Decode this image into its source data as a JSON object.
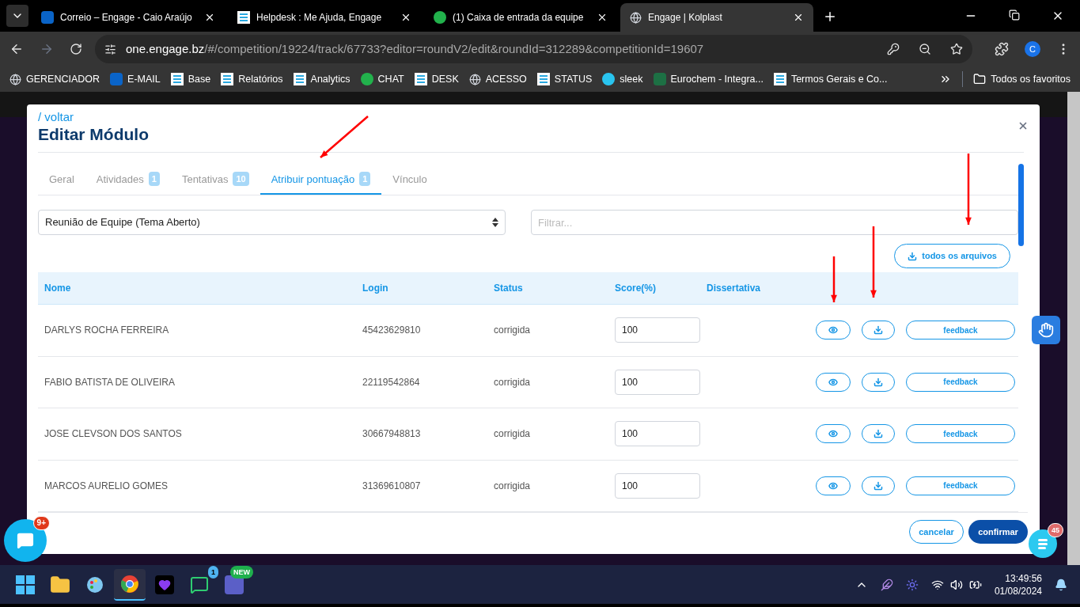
{
  "browser": {
    "tabs": [
      {
        "title": "Correio – Engage - Caio Araújo",
        "selected": false,
        "kind": "outlook"
      },
      {
        "title": "Helpdesk : Me Ajuda, Engage",
        "selected": false,
        "kind": "engage"
      },
      {
        "title": "(1) Caixa de entrada da equipe",
        "selected": false,
        "kind": "chat"
      },
      {
        "title": "Engage | Kolplast",
        "selected": true,
        "kind": "globe"
      }
    ],
    "url_host": "one.engage.bz",
    "url_path": "/#/competition/19224/track/67733?editor=roundV2/edit&roundId=312289&competitionId=19607",
    "profile": "C",
    "bookmarks": [
      {
        "label": "GERENCIADOR",
        "kind": "globe"
      },
      {
        "label": "E-MAIL",
        "kind": "outlook"
      },
      {
        "label": "Base",
        "kind": "engage"
      },
      {
        "label": "Relatórios",
        "kind": "engage"
      },
      {
        "label": "Analytics",
        "kind": "engage"
      },
      {
        "label": "CHAT",
        "kind": "chat"
      },
      {
        "label": "DESK",
        "kind": "engage"
      },
      {
        "label": "ACESSO",
        "kind": "globe"
      },
      {
        "label": "STATUS",
        "kind": "engage"
      },
      {
        "label": "sleek",
        "kind": "sleek"
      },
      {
        "label": "Eurochem - Integra...",
        "kind": "excel"
      },
      {
        "label": "Termos Gerais e Co...",
        "kind": "engage"
      }
    ],
    "all_bookmarks": "Todos os favoritos"
  },
  "page": {
    "chat_badge": "9+",
    "helper_badge": "45"
  },
  "modal": {
    "back": "/ voltar",
    "title": "Editar Módulo",
    "tabs": [
      {
        "label": "Geral",
        "selected": false
      },
      {
        "label": "Atividades",
        "count": "1",
        "selected": false
      },
      {
        "label": "Tentativas",
        "count": "10",
        "selected": false
      },
      {
        "label": "Atribuir pontuação",
        "count": "1",
        "selected": true
      },
      {
        "label": "Vínculo",
        "selected": false
      }
    ],
    "select_value": "Reunião de Equipe (Tema Aberto)",
    "filter_placeholder": "Filtrar...",
    "download_all": "todos os arquivos",
    "columns": [
      "Nome",
      "Login",
      "Status",
      "Score(%)",
      "Dissertativa"
    ],
    "rows": [
      {
        "name": "DARLYS ROCHA FERREIRA",
        "login": "45423629810",
        "status": "corrigida",
        "score": "100",
        "action": "feedback"
      },
      {
        "name": "FABIO BATISTA DE OLIVEIRA",
        "login": "22119542864",
        "status": "corrigida",
        "score": "100",
        "action": "feedback"
      },
      {
        "name": "JOSE CLEVSON DOS SANTOS",
        "login": "30667948813",
        "status": "corrigida",
        "score": "100",
        "action": "feedback"
      },
      {
        "name": "MARCOS AURELIO GOMES",
        "login": "31369610807",
        "status": "corrigida",
        "score": "100",
        "action": "feedback"
      }
    ],
    "cancel": "cancelar",
    "confirm": "confirmar"
  },
  "taskbar": {
    "apps": [
      {
        "kind": "start",
        "selected": false
      },
      {
        "kind": "files",
        "selected": false
      },
      {
        "kind": "paint",
        "selected": false
      },
      {
        "kind": "chrome",
        "selected": true
      },
      {
        "kind": "heart",
        "selected": false
      },
      {
        "kind": "whatsapp",
        "selected": false,
        "badge": "1"
      },
      {
        "kind": "teams",
        "selected": false,
        "badge": "NEW"
      }
    ],
    "time": "13:49:56",
    "date": "01/08/2024"
  }
}
